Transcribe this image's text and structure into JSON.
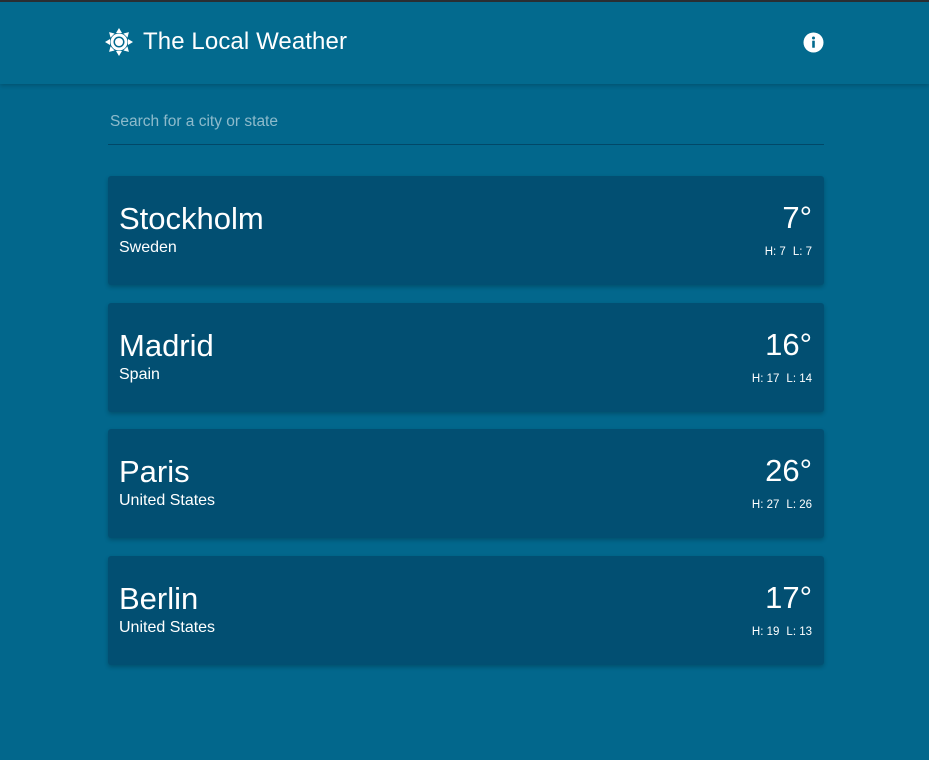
{
  "header": {
    "title": "The Local Weather",
    "logo_icon": "sun-icon",
    "info_icon": "info-icon"
  },
  "search": {
    "placeholder": "Search for a city or state",
    "value": ""
  },
  "cities": [
    {
      "name": "Stockholm",
      "country": "Sweden",
      "temp": "7°",
      "high": "H: 7",
      "low": "L: 7"
    },
    {
      "name": "Madrid",
      "country": "Spain",
      "temp": "16°",
      "high": "H: 17",
      "low": "L: 14"
    },
    {
      "name": "Paris",
      "country": "United States",
      "temp": "26°",
      "high": "H: 27",
      "low": "L: 26"
    },
    {
      "name": "Berlin",
      "country": "United States",
      "temp": "17°",
      "high": "H: 19",
      "low": "L: 13"
    }
  ],
  "colors": {
    "background": "#02678c",
    "card": "#024f72",
    "text": "#ffffff"
  }
}
